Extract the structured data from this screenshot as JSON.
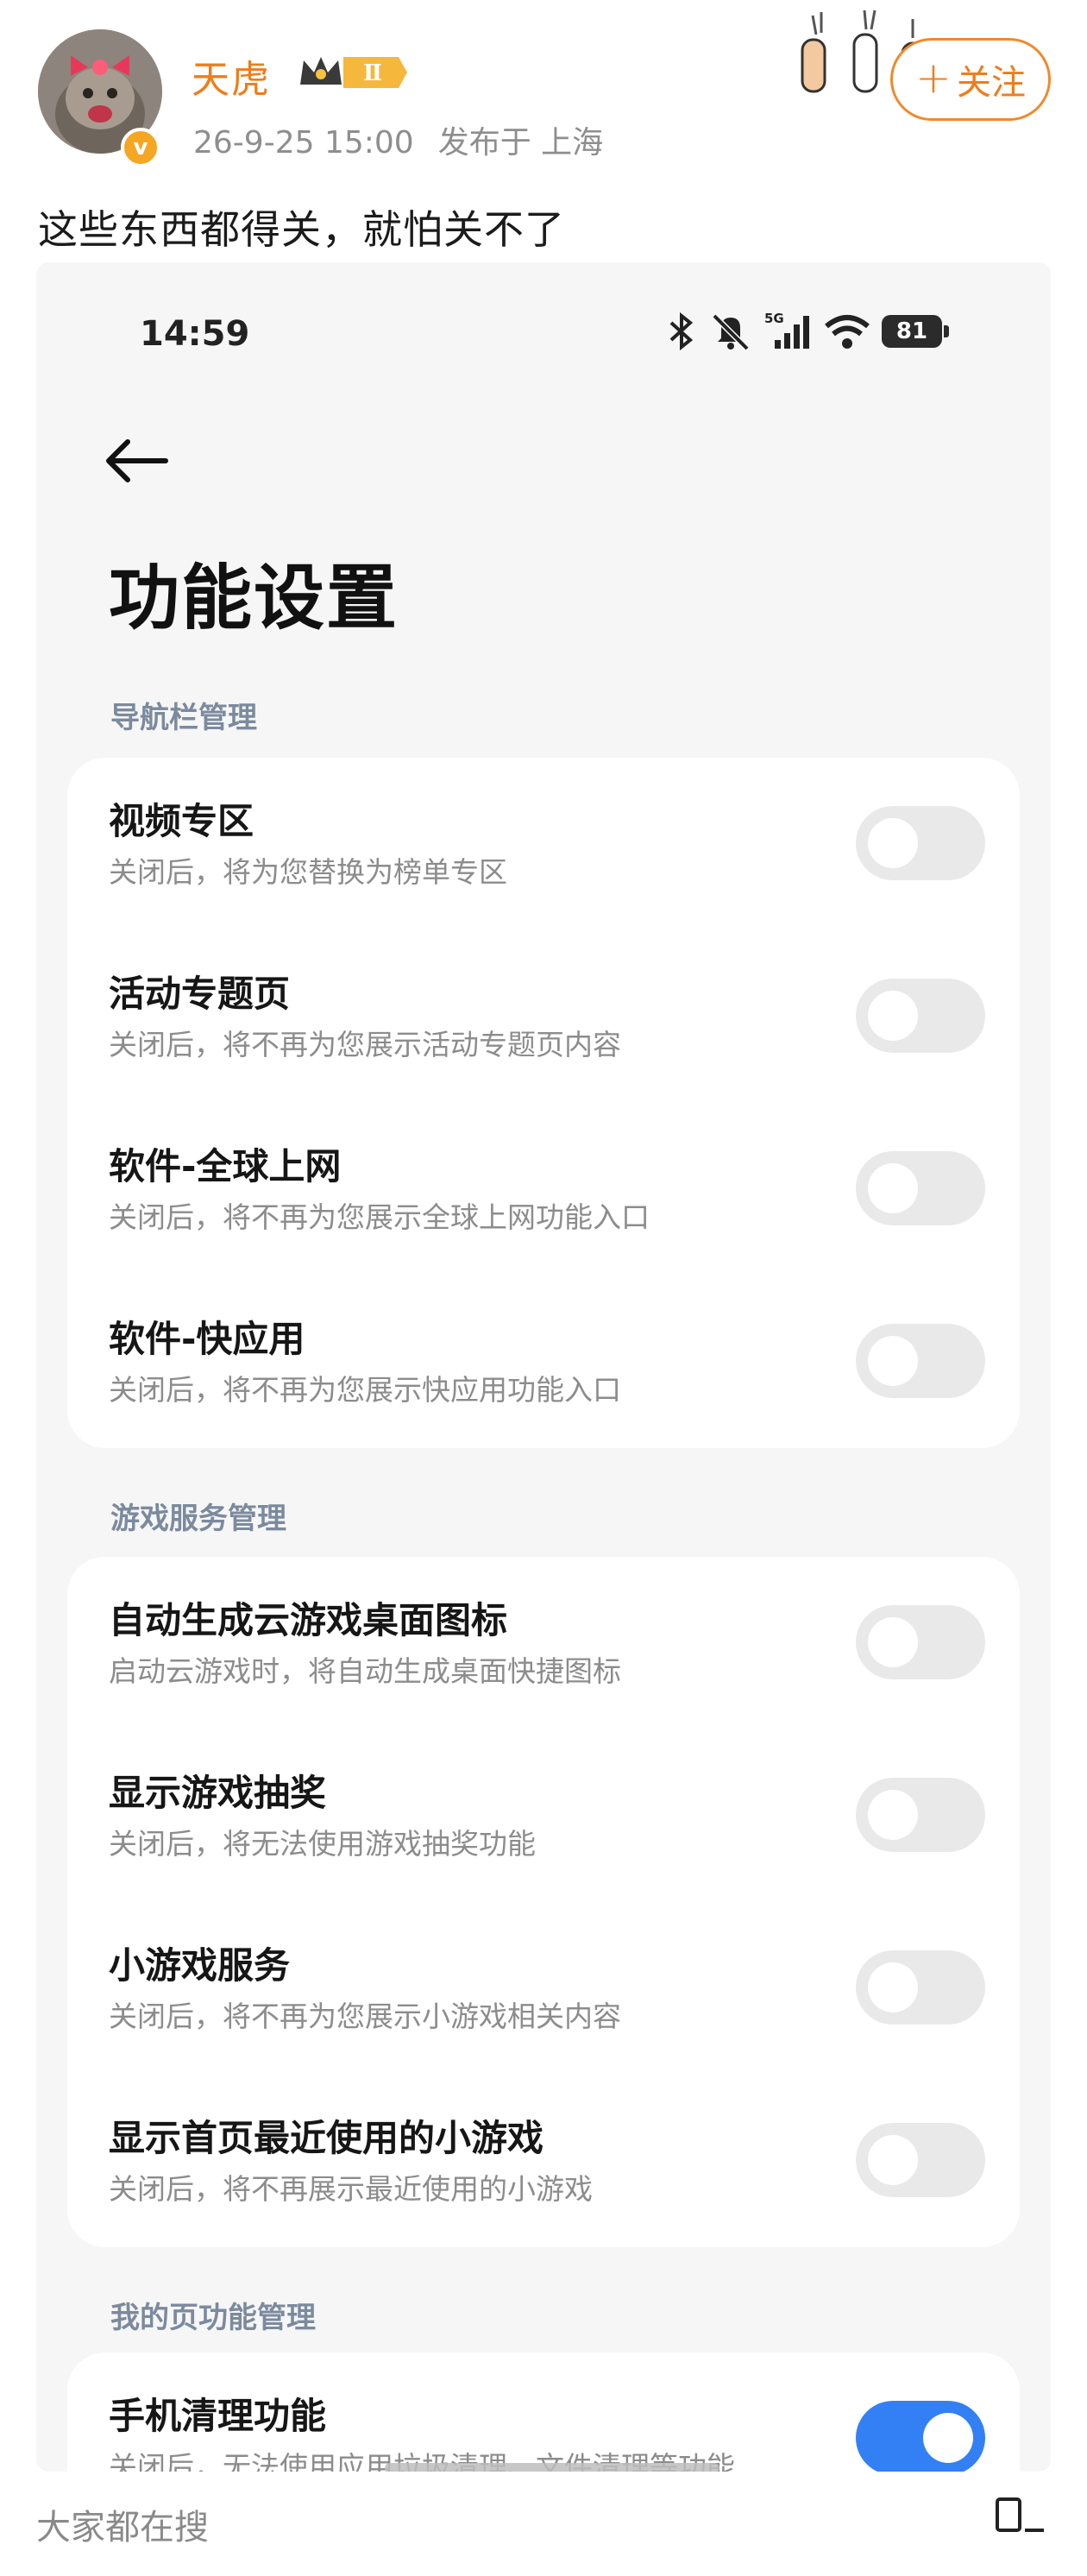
{
  "post": {
    "username": "天虎",
    "vip_level": "Ⅱ",
    "date": "26-9-25 15:00",
    "location": "发布于 上海",
    "follow_label": "关注",
    "text": "这些东西都得关，就怕关不了"
  },
  "screenshot": {
    "status_time": "14:59",
    "battery": "81",
    "network": "5G",
    "page_title": "功能设置",
    "sections": [
      {
        "header": "导航栏管理",
        "items": [
          {
            "title": "视频专区",
            "desc": "关闭后，将为您替换为榜单专区",
            "on": false
          },
          {
            "title": "活动专题页",
            "desc": "关闭后，将不再为您展示活动专题页内容",
            "on": false
          },
          {
            "title": "软件-全球上网",
            "desc": "关闭后，将不再为您展示全球上网功能入口",
            "on": false
          },
          {
            "title": "软件-快应用",
            "desc": "关闭后，将不再为您展示快应用功能入口",
            "on": false
          }
        ]
      },
      {
        "header": "游戏服务管理",
        "items": [
          {
            "title": "自动生成云游戏桌面图标",
            "desc": "启动云游戏时，将自动生成桌面快捷图标",
            "on": false
          },
          {
            "title": "显示游戏抽奖",
            "desc": "关闭后，将无法使用游戏抽奖功能",
            "on": false
          },
          {
            "title": "小游戏服务",
            "desc": "关闭后，将不再为您展示小游戏相关内容",
            "on": false
          },
          {
            "title": "显示首页最近使用的小游戏",
            "desc": "关闭后，将不再展示最近使用的小游戏",
            "on": false
          }
        ]
      },
      {
        "header": "我的页功能管理",
        "items": [
          {
            "title": "手机清理功能",
            "desc": "关闭后，无法使用应用垃圾清理、文件清理等功能",
            "on": true
          }
        ]
      }
    ]
  },
  "bottom": {
    "label": "大家都在搜"
  },
  "colors": {
    "accent_orange": "#f07c1a",
    "toggle_on": "#3380f5",
    "toggle_off": "#e9e9e9",
    "section_header": "#7c8a9e"
  },
  "icons": [
    "back-arrow-icon",
    "bluetooth-icon",
    "mute-icon",
    "signal-icon",
    "wifi-icon",
    "battery-icon",
    "plus-icon",
    "verified-icon",
    "crown-icon",
    "cat-paw-decoration",
    "edit-icon"
  ]
}
